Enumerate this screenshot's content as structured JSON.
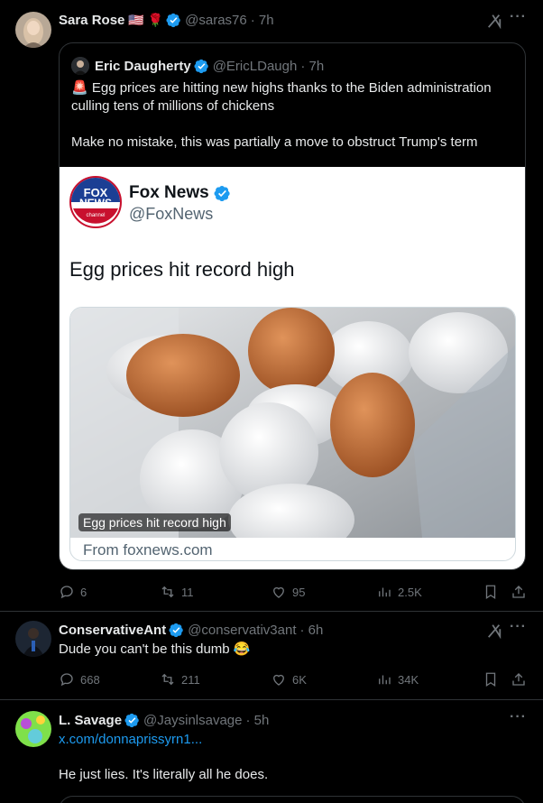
{
  "posts": [
    {
      "author": "Sara Rose",
      "flags": "🇺🇸 🌹",
      "handle": "@saras76",
      "time": "· 7h",
      "quote": {
        "author": "Eric Daugherty",
        "handle": "@EricLDaugh",
        "time": "· 7h",
        "text1": "🚨 Egg prices are hitting new highs thanks to the Biden administration culling tens of millions of chickens",
        "text2": "Make no mistake, this was partially a move to obstruct Trump's term",
        "card": {
          "name": "Fox News",
          "handle": "@FoxNews",
          "headline": "Egg prices hit record high",
          "image_caption": "Egg prices hit record high",
          "from": "From foxnews.com"
        }
      },
      "stats": {
        "replies": "6",
        "reposts": "11",
        "likes": "95",
        "views": "2.5K"
      }
    },
    {
      "author": "ConservativeAnt",
      "handle": "@conservativ3ant",
      "time": "· 6h",
      "text": "Dude you can't be this dumb 😂",
      "stats": {
        "replies": "668",
        "reposts": "211",
        "likes": "6K",
        "views": "34K"
      }
    },
    {
      "author": "L. Savage",
      "handle": "@Jaysinlsavage",
      "time": "· 5h",
      "link": "x.com/donnaprissyrn1...",
      "text": "He just lies. It's literally all he does."
    }
  ],
  "colors": {
    "accent": "#1d9bf0",
    "muted": "#71767b",
    "border": "#2f3336",
    "background": "#000000"
  },
  "icons": [
    "verified-badge-icon",
    "grok-icon",
    "more-icon",
    "reply-icon",
    "repost-icon",
    "like-icon",
    "views-icon",
    "bookmark-icon",
    "share-icon"
  ]
}
